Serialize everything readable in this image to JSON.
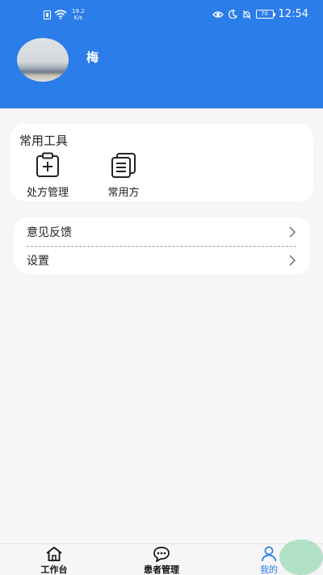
{
  "status_bar": {
    "speed_value": "19.2",
    "speed_unit": "K/s",
    "battery": "70",
    "time": "12:54"
  },
  "profile": {
    "name": "梅"
  },
  "tools": {
    "title": "常用工具",
    "items": [
      {
        "label": "处方管理",
        "icon": "prescription-clipboard-icon"
      },
      {
        "label": "常用方",
        "icon": "document-stack-icon"
      }
    ]
  },
  "menu": {
    "items": [
      {
        "label": "意见反馈"
      },
      {
        "label": "设置"
      }
    ]
  },
  "bottom_nav": {
    "items": [
      {
        "label": "工作台",
        "icon": "home-icon"
      },
      {
        "label": "患者管理",
        "icon": "chat-bubble-icon"
      },
      {
        "label": "我的",
        "icon": "person-icon",
        "active": true
      }
    ],
    "active_color": "#2b7de9"
  },
  "colors": {
    "header_bg": "#2b7de9",
    "page_bg": "#f7f5f7",
    "card_bg": "#ffffff"
  }
}
